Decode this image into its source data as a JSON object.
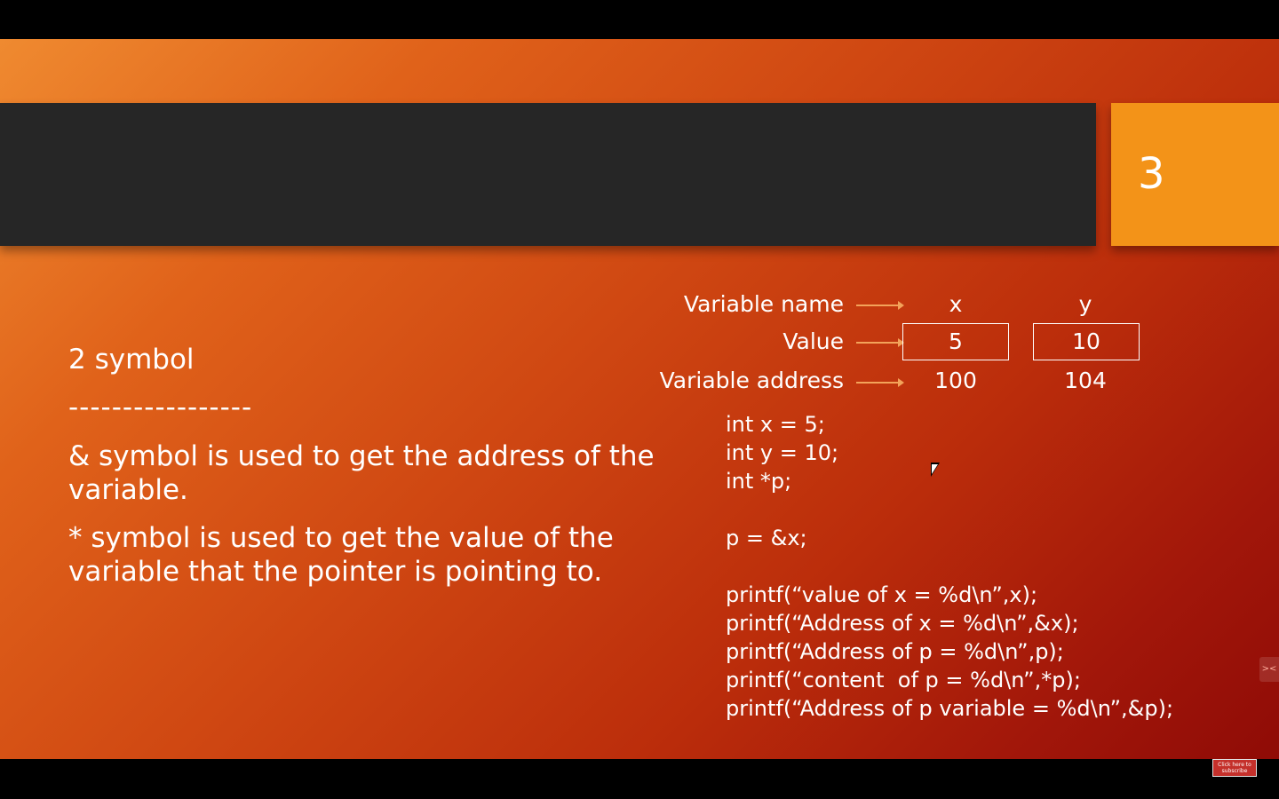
{
  "slide": {
    "number": "3",
    "heading": "2 symbol",
    "divider": "-----------------",
    "bullet_ampersand": "& symbol is used to get the address of the variable.",
    "bullet_asterisk": "* symbol is used to get the value of the variable that the pointer is pointing to."
  },
  "diagram": {
    "labels": {
      "name": "Variable name",
      "value": "Value",
      "address": "Variable address"
    },
    "variables": [
      {
        "name": "x",
        "value": "5",
        "address": "100"
      },
      {
        "name": "y",
        "value": "10",
        "address": "104"
      }
    ]
  },
  "code": [
    "int x = 5;",
    "int y = 10;",
    "int *p;",
    "",
    "p = &x;",
    "",
    "printf(“value of x = %d\\n”,x);",
    "printf(“Address of x = %d\\n”,&x);",
    "printf(“Address of p = %d\\n”,p);",
    "printf(“content  of p = %d\\n”,*p);",
    "printf(“Address of p variable = %d\\n”,&p);"
  ],
  "overlay": {
    "subscribe_label": "Click here to subscribe",
    "side_tab_icon": "expand-icon"
  },
  "colors": {
    "title_band": "#262626",
    "number_box": "#f39318",
    "arrow": "#f3a35a"
  }
}
